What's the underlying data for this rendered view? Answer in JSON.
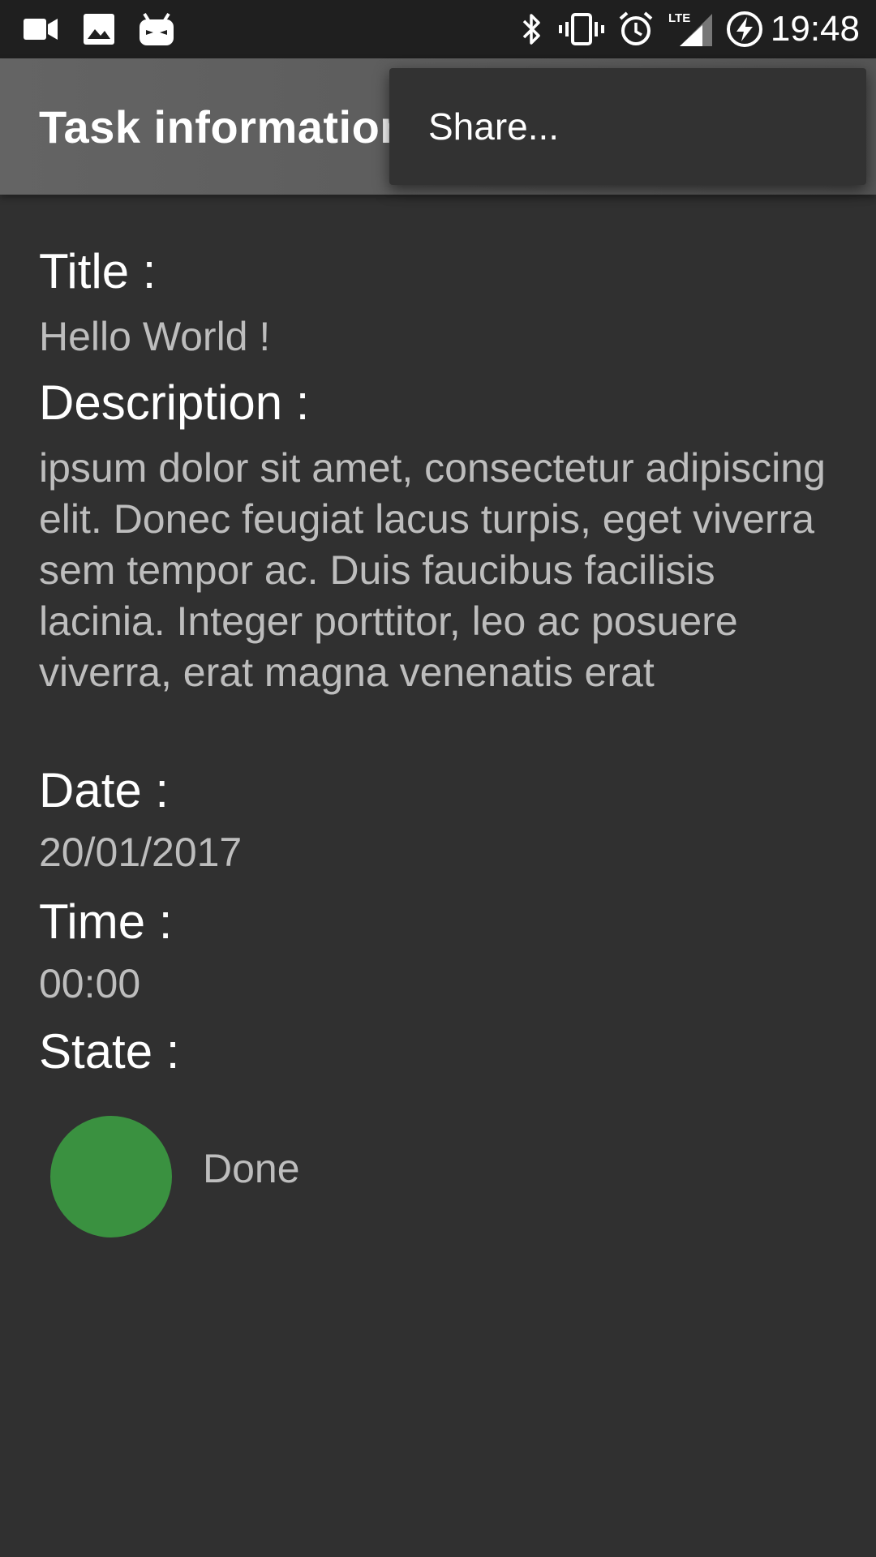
{
  "status_bar": {
    "time": "19:48",
    "network_label": "LTE",
    "left_icons": [
      "video-camera-icon",
      "image-icon",
      "cyanogen-mascot-icon"
    ],
    "right_icons": [
      "bluetooth-icon",
      "vibrate-icon",
      "alarm-icon",
      "lte-signal-icon",
      "battery-charging-icon"
    ]
  },
  "app_bar": {
    "title": "Task information"
  },
  "overflow_menu": {
    "items": [
      {
        "label": "Share..."
      }
    ]
  },
  "task": {
    "title_label": "Title :",
    "title_value": "Hello World !",
    "description_label": "Description :",
    "description_value": " ipsum dolor sit amet, consectetur adipiscing elit. Donec feugiat lacus turpis, eget viverra sem tempor ac. Duis faucibus facilisis lacinia. Integer porttitor, leo ac posuere viverra, erat magna venenatis erat",
    "date_label": "Date :",
    "date_value": "20/01/2017",
    "time_label": "Time :",
    "time_value": "00:00",
    "state_label": "State :",
    "state_value": "Done",
    "state_color": "#3a9140"
  },
  "colors": {
    "background": "#303030",
    "status_bar": "#1f1f1f",
    "app_bar": "#5c5c5c",
    "menu": "#323232",
    "label_text": "#ffffff",
    "value_text": "#bdbdbd"
  }
}
